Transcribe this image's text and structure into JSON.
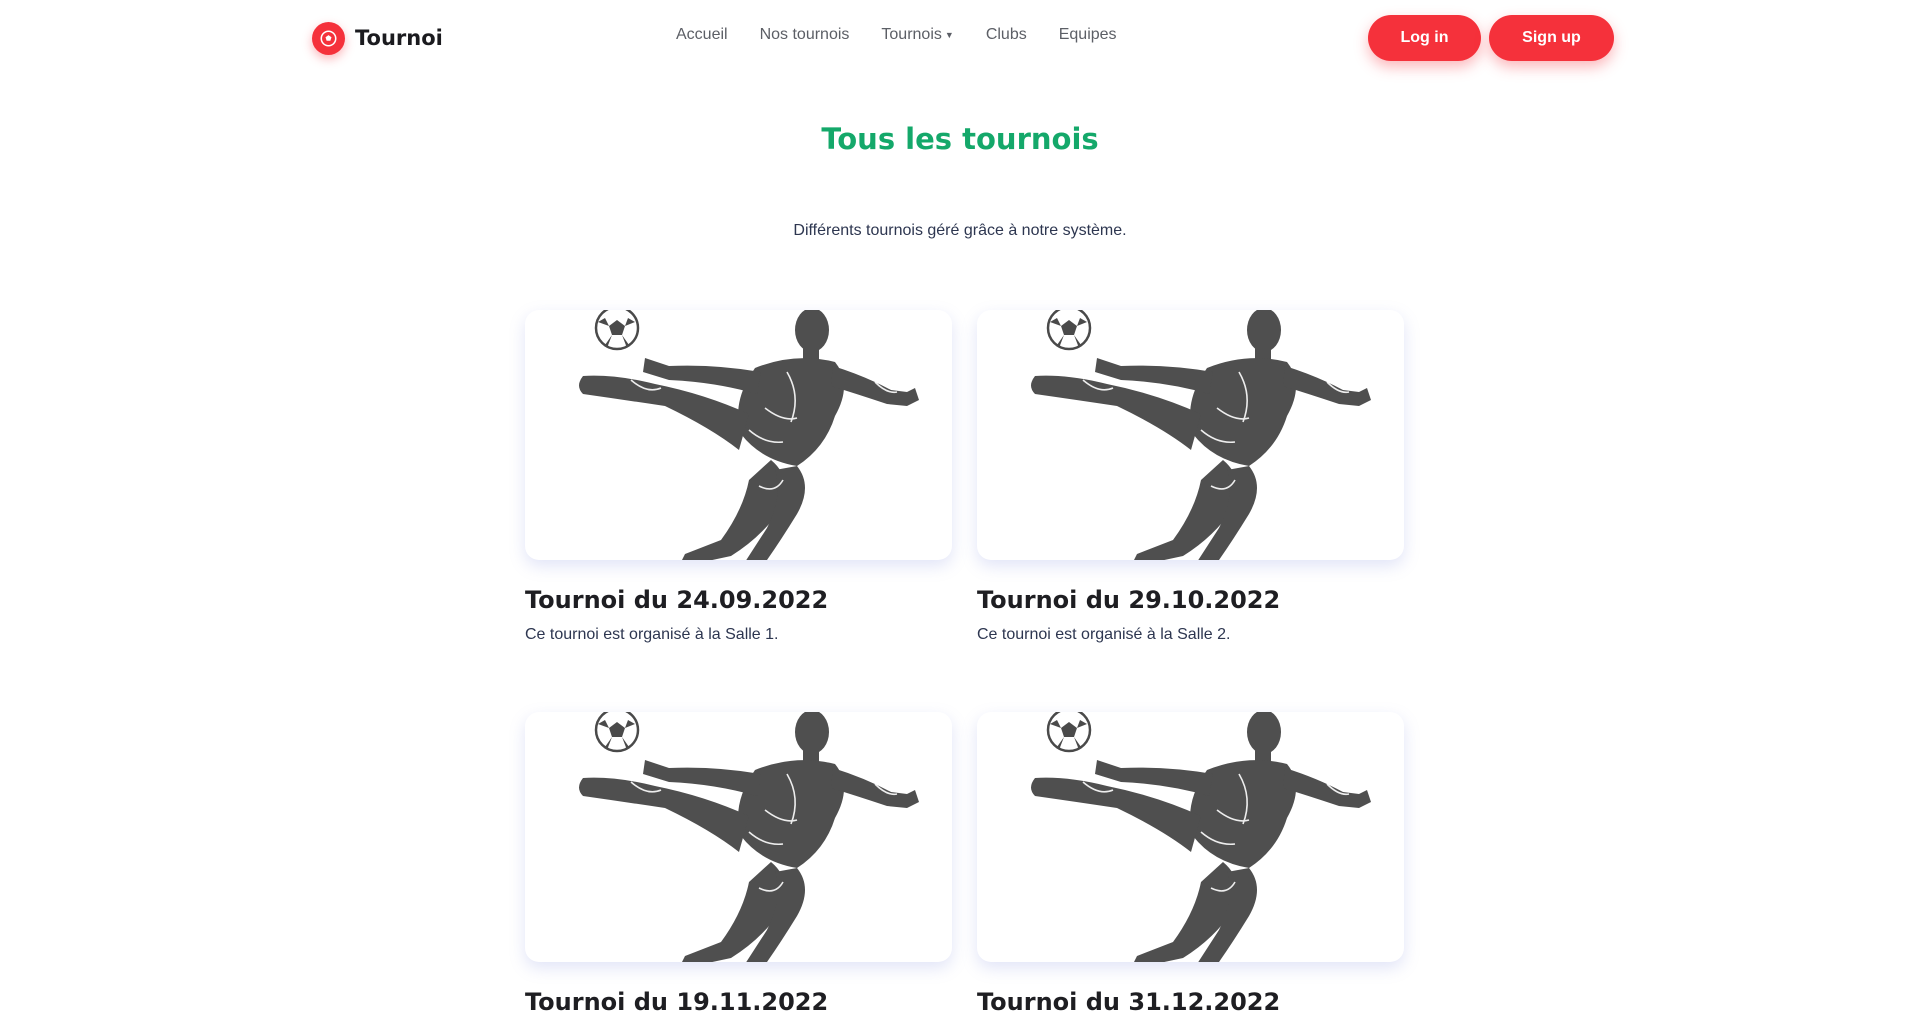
{
  "brand": {
    "name": "Tournoi",
    "icon": "soccer-ball-icon"
  },
  "nav": {
    "links": [
      {
        "label": "Accueil"
      },
      {
        "label": "Nos tournois"
      },
      {
        "label": "Tournois",
        "dropdown": true
      },
      {
        "label": "Clubs"
      },
      {
        "label": "Equipes"
      }
    ]
  },
  "auth": {
    "login_label": "Log in",
    "signup_label": "Sign up"
  },
  "colors": {
    "accent_red": "#f5313b",
    "title_green": "#14a86a"
  },
  "main": {
    "title": "Tous les tournois",
    "subtitle": "Différents tournois géré grâce à notre système.",
    "cards": [
      {
        "title": "Tournoi du 24.09.2022",
        "text": "Ce tournoi est organisé à la Salle 1.",
        "image_icon": "soccer-player-icon"
      },
      {
        "title": "Tournoi du 29.10.2022",
        "text": "Ce tournoi est organisé à la Salle 2.",
        "image_icon": "soccer-player-icon"
      },
      {
        "title": "Tournoi du 19.11.2022",
        "text": "",
        "image_icon": "soccer-player-icon"
      },
      {
        "title": "Tournoi du 31.12.2022",
        "text": "",
        "image_icon": "soccer-player-icon"
      }
    ]
  }
}
